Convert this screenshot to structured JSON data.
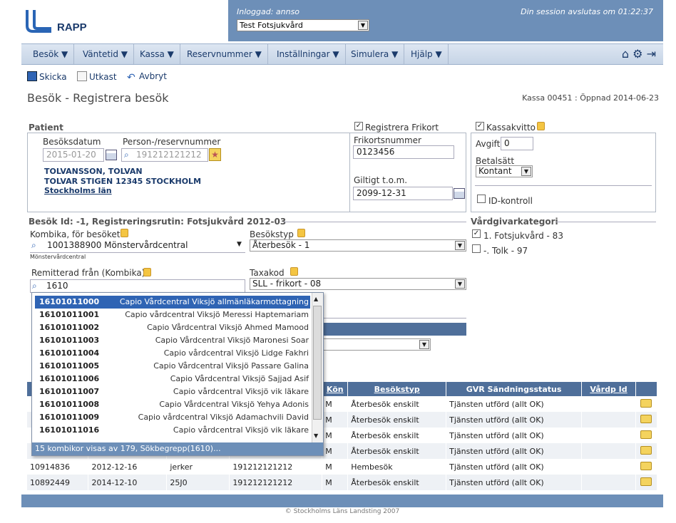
{
  "header": {
    "app_name": "RAPP",
    "logged_in": "Inloggad: annso",
    "session": "Din session avslutas om 01:22:37",
    "unit": "Test Fotsjukvård"
  },
  "menu": [
    "Besök ▼",
    "Väntetid ▼",
    "Kassa ▼",
    "Reservnummer ▼",
    "Inställningar ▼",
    "Simulera ▼",
    "Hjälp ▼"
  ],
  "toolbar": {
    "send": "Skicka",
    "draft": "Utkast",
    "cancel": "Avbryt"
  },
  "page": {
    "title": "Besök - Registrera besök",
    "kassa": "Kassa 00451 : Öppnad 2014-06-23"
  },
  "patient": {
    "section": "Patient",
    "date_label": "Besöksdatum",
    "date_value": "2015-01-20",
    "pnr_label": "Person-/reservnummer",
    "pnr_value": "191212121212",
    "name": "TOLVANSSON, TOLVAN",
    "address": "TOLVAR STIGEN  12345  STOCKHOLM",
    "county": "Stockholms län"
  },
  "frikort": {
    "check_label": "Registrera Frikort",
    "number_label": "Frikortsnummer",
    "number_value": "0123456",
    "valid_label": "Giltigt t.o.m.",
    "valid_value": "2099-12-31"
  },
  "kassakvitto": {
    "check_label": "Kassakvitto",
    "fee_label": "Avgift",
    "fee_value": "0",
    "pay_label": "Betalsätt",
    "pay_value": "Kontant",
    "id_label": "ID-kontroll"
  },
  "visit": {
    "section": "Besök  Id: -1, Registreringsrutin: Fotsjukvård 2012-03",
    "kombika_label": "Kombika, för besöket",
    "kombika_value": "1001388900  Mönstervårdcentral",
    "kombika_sub": "Mönstervårdcentral",
    "type_label": "Besökstyp",
    "type_value": "Återbesök - 1",
    "referred_label": "Remitterad från (Kombika)",
    "referred_value": "1610",
    "tax_label": "Taxakod",
    "tax_value": "SLL - frikort - 08"
  },
  "category": {
    "section": "Vårdgivarkategori",
    "items": [
      "1. Fotsjukvård - 83",
      "-. Tolk - 97"
    ]
  },
  "autocomplete": {
    "rows": [
      {
        "code": "16101011000",
        "name": "Capio Vårdcentral Viksjö allmänläkarmottagning"
      },
      {
        "code": "16101011001",
        "name": "Capio vårdcentral Viksjö Meressi Haptemariam"
      },
      {
        "code": "16101011002",
        "name": "Capio Vårdcentral Viksjö Ahmed Mamood"
      },
      {
        "code": "16101011003",
        "name": "Capio Vårdcentral Viksjö Maronesi Soar"
      },
      {
        "code": "16101011004",
        "name": "Capio vårdcentral Viksjö Lidge Fakhri"
      },
      {
        "code": "16101011005",
        "name": "Capio Vårdcentral Viksjö Passare Galina"
      },
      {
        "code": "16101011006",
        "name": "Capio Vårdcentral Viksjö Sajjad Asif"
      },
      {
        "code": "16101011007",
        "name": "Capio vårdcentral Viksjö vik läkare"
      },
      {
        "code": "16101011008",
        "name": "Capio Vårdcentral Viksjö Yehya Adonis"
      },
      {
        "code": "16101011009",
        "name": "Capio vårdcentral Viksjö Adamachvili David"
      },
      {
        "code": "16101011016",
        "name": "Capio vårdcentral Viksjö vik läkare"
      }
    ],
    "footer": "15 kombikor visas av 179, Sökbegrepp(1610)..."
  },
  "table": {
    "headers": [
      "Kön",
      "Besökstyp",
      "GVR Sändningsstatus",
      "Vårdp Id"
    ],
    "rows": [
      [
        "",
        "",
        "",
        "",
        "M",
        "Återbesök enskilt",
        "Tjänsten utförd (allt OK)"
      ],
      [
        "",
        "",
        "",
        "",
        "M",
        "Återbesök enskilt",
        "Tjänsten utförd (allt OK)"
      ],
      [
        "",
        "",
        "",
        "",
        "M",
        "Återbesök enskilt",
        "Tjänsten utförd (allt OK)"
      ],
      [
        "",
        "",
        "",
        "",
        "M",
        "Återbesök enskilt",
        "Tjänsten utförd (allt OK)"
      ],
      [
        "10914836",
        "2012-12-16",
        "jerker",
        "191212121212",
        "M",
        "Hembesök",
        "Tjänsten utförd (allt OK)"
      ],
      [
        "10892449",
        "2014-12-10",
        "25J0",
        "191212121212",
        "M",
        "Återbesök enskilt",
        "Tjänsten utförd (allt OK)"
      ]
    ]
  },
  "footer": {
    "copyright": "© Stockholms Läns Landsting 2007"
  }
}
